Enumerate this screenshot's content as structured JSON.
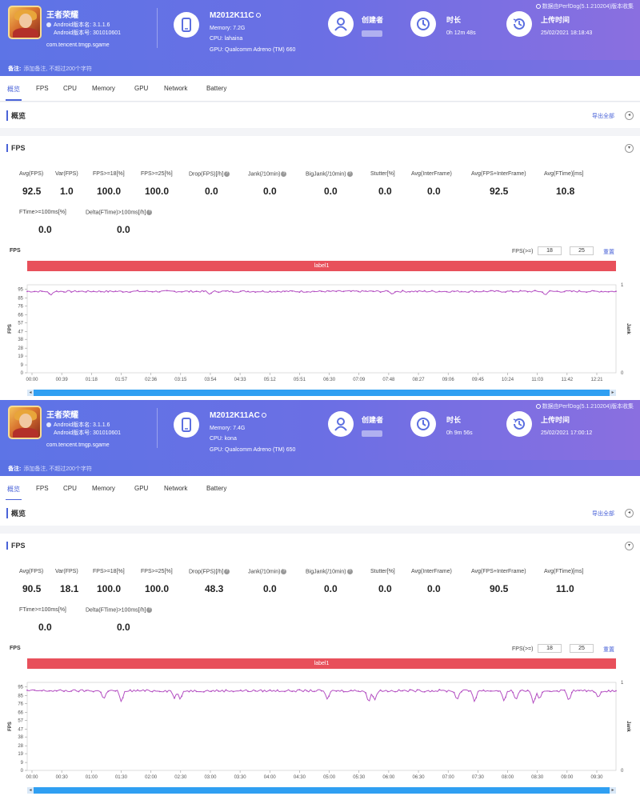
{
  "panels": [
    {
      "app": {
        "name": "王者荣耀",
        "android_version": "Android版本名: 3.1.1.6",
        "android_code": "Android版本号: 301010601",
        "package": "com.tencent.tmgp.sgame"
      },
      "device": {
        "model": "M2012K11C",
        "memory": "Memory: 7.2G",
        "cpu": "CPU: lahaina",
        "gpu": "GPU: Qualcomm Adreno (TM) 660"
      },
      "creator_label": "创建者",
      "duration_label": "时长",
      "duration_value": "0h 12m 48s",
      "upload_label": "上传时间",
      "upload_value": "25/02/2021 18:18:43",
      "source_note": "数据由PerfDog(5.1.210204)版本收集",
      "note_label": "备注:",
      "note_placeholder": "添加备注, 不超过200个字符",
      "tabs": [
        "概览",
        "FPS",
        "CPU",
        "Memory",
        "GPU",
        "Network",
        "Battery"
      ],
      "overview_title": "概览",
      "export_label": "导出全部",
      "fps_title": "FPS",
      "metrics_row1": [
        {
          "label": "Avg(FPS)",
          "value": "92.5"
        },
        {
          "label": "Var(FPS)",
          "value": "1.0"
        },
        {
          "label": "FPS>=18[%]",
          "value": "100.0"
        },
        {
          "label": "FPS>=25[%]",
          "value": "100.0"
        },
        {
          "label": "Drop(FPS)[/h]",
          "value": "0.0"
        },
        {
          "label": "Jank(/10min)",
          "value": "0.0"
        },
        {
          "label": "BigJank(/10min)",
          "value": "0.0"
        },
        {
          "label": "Stutter[%]",
          "value": "0.0"
        },
        {
          "label": "Avg(InterFrame)",
          "value": "0.0"
        },
        {
          "label": "Avg(FPS+InterFrame)",
          "value": "92.5"
        },
        {
          "label": "Avg(FTime)[ms]",
          "value": "10.8"
        }
      ],
      "metrics_row2": [
        {
          "label": "FTime>=100ms[%]",
          "value": "0.0"
        },
        {
          "label": "Delta(FTime)>100ms[/h]",
          "value": "0.0"
        }
      ],
      "chart_title": "FPS",
      "filter_label": "FPS(>=)",
      "filter_a": "18",
      "filter_b": "25",
      "reset_label": "重置",
      "band_label": "label1",
      "chart_data": {
        "type": "line",
        "yticks": [
          "95",
          "85",
          "76",
          "66",
          "57",
          "47",
          "38",
          "28",
          "19",
          "9",
          "0"
        ],
        "y2ticks": [
          "1",
          "0"
        ],
        "ylabel": "FPS",
        "y2label": "Jank",
        "xticks": [
          "00:00",
          "00:39",
          "01:18",
          "01:57",
          "02:36",
          "03:15",
          "03:54",
          "04:33",
          "05:12",
          "05:51",
          "06:30",
          "07:09",
          "07:48",
          "08:27",
          "09:06",
          "09:45",
          "10:24",
          "11:03",
          "11:42",
          "12:21"
        ],
        "ylim": [
          0,
          100
        ],
        "series_color": "#b44fc2",
        "base_value": 92.5,
        "dips": [
          [
            0.04,
            88
          ],
          [
            0.31,
            89
          ],
          [
            0.62,
            89
          ],
          [
            0.88,
            88
          ]
        ]
      }
    },
    {
      "app": {
        "name": "王者荣耀",
        "android_version": "Android版本名: 3.1.1.6",
        "android_code": "Android版本号: 301010601",
        "package": "com.tencent.tmgp.sgame"
      },
      "device": {
        "model": "M2012K11AC",
        "memory": "Memory: 7.4G",
        "cpu": "CPU: kona",
        "gpu": "GPU: Qualcomm Adreno (TM) 650"
      },
      "creator_label": "创建者",
      "duration_label": "时长",
      "duration_value": "0h 9m 56s",
      "upload_label": "上传时间",
      "upload_value": "25/02/2021 17:00:12",
      "source_note": "数据由PerfDog(5.1.210204)版本收集",
      "note_label": "备注:",
      "note_placeholder": "添加备注, 不超过200个字符",
      "tabs": [
        "概览",
        "FPS",
        "CPU",
        "Memory",
        "GPU",
        "Network",
        "Battery"
      ],
      "overview_title": "概览",
      "export_label": "导出全部",
      "fps_title": "FPS",
      "metrics_row1": [
        {
          "label": "Avg(FPS)",
          "value": "90.5"
        },
        {
          "label": "Var(FPS)",
          "value": "18.1"
        },
        {
          "label": "FPS>=18[%]",
          "value": "100.0"
        },
        {
          "label": "FPS>=25[%]",
          "value": "100.0"
        },
        {
          "label": "Drop(FPS)[/h]",
          "value": "48.3"
        },
        {
          "label": "Jank(/10min)",
          "value": "0.0"
        },
        {
          "label": "BigJank(/10min)",
          "value": "0.0"
        },
        {
          "label": "Stutter[%]",
          "value": "0.0"
        },
        {
          "label": "Avg(InterFrame)",
          "value": "0.0"
        },
        {
          "label": "Avg(FPS+InterFrame)",
          "value": "90.5"
        },
        {
          "label": "Avg(FTime)[ms]",
          "value": "11.0"
        }
      ],
      "metrics_row2": [
        {
          "label": "FTime>=100ms[%]",
          "value": "0.0"
        },
        {
          "label": "Delta(FTime)>100ms[/h]",
          "value": "0.0"
        }
      ],
      "chart_title": "FPS",
      "filter_label": "FPS(>=)",
      "filter_a": "18",
      "filter_b": "25",
      "reset_label": "重置",
      "band_label": "label1",
      "chart_data": {
        "type": "line",
        "yticks": [
          "95",
          "85",
          "76",
          "66",
          "57",
          "47",
          "38",
          "28",
          "19",
          "9",
          "0"
        ],
        "y2ticks": [
          "1",
          "0"
        ],
        "ylabel": "FPS",
        "y2label": "Jank",
        "xticks": [
          "00:00",
          "00:30",
          "01:00",
          "01:30",
          "02:00",
          "02:30",
          "03:00",
          "03:30",
          "04:00",
          "04:30",
          "05:00",
          "05:30",
          "06:00",
          "06:30",
          "07:00",
          "07:30",
          "08:00",
          "08:30",
          "09:00",
          "09:30"
        ],
        "ylim": [
          0,
          100
        ],
        "series_color": "#b44fc2",
        "base_value": 90.5,
        "dips": [
          [
            0.13,
            80
          ],
          [
            0.16,
            77
          ],
          [
            0.25,
            82
          ],
          [
            0.26,
            80
          ],
          [
            0.51,
            80
          ],
          [
            0.58,
            76
          ],
          [
            0.59,
            79
          ],
          [
            0.73,
            79
          ],
          [
            0.76,
            77
          ],
          [
            0.81,
            78
          ],
          [
            0.83,
            79
          ],
          [
            0.86,
            75
          ],
          [
            0.87,
            80
          ],
          [
            0.92,
            78
          ],
          [
            0.97,
            82
          ]
        ]
      }
    }
  ]
}
